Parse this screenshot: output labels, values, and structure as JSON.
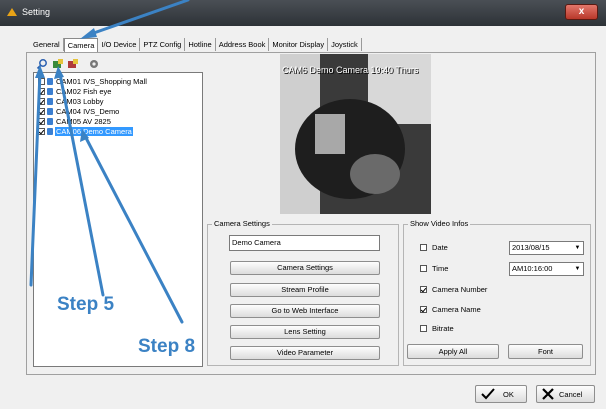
{
  "window": {
    "title": "Setting",
    "close_glyph": "x"
  },
  "tabs": [
    "General",
    "Camera",
    "I/O Device",
    "PTZ Config",
    "Hotline",
    "Address Book",
    "Monitor Display",
    "Joystick"
  ],
  "active_tab": "Camera",
  "toolbar": {
    "icons": [
      "search-icon",
      "add-camera-icon",
      "delete-camera-icon",
      "settings-gear-icon"
    ]
  },
  "cameras": [
    {
      "label": "CAM01 IVS_Shopping Mall",
      "checked": false,
      "selected": false
    },
    {
      "label": "CAM02 Fish eye",
      "checked": true,
      "selected": false
    },
    {
      "label": "CAM03 Lobby",
      "checked": true,
      "selected": false
    },
    {
      "label": "CAM04 IVS_Demo",
      "checked": true,
      "selected": false
    },
    {
      "label": "CAM05 AV 2825",
      "checked": true,
      "selected": false
    },
    {
      "label": "CAM06 Demo Camera",
      "checked": true,
      "selected": true
    }
  ],
  "video": {
    "overlay_text": "CAM6 Demo Camera 19:40 Thurs"
  },
  "camera_settings": {
    "legend": "Camera Settings",
    "name_value": "Demo Camera",
    "buttons": [
      "Camera Settings",
      "Stream Profile",
      "Go to Web Interface",
      "Lens Setting",
      "Video Parameter"
    ]
  },
  "show_video_infos": {
    "legend": "Show Video Infos",
    "options": [
      {
        "label": "Date",
        "checked": false
      },
      {
        "label": "Time",
        "checked": false
      },
      {
        "label": "Camera Number",
        "checked": true
      },
      {
        "label": "Camera Name",
        "checked": true
      },
      {
        "label": "Bitrate",
        "checked": false
      }
    ],
    "date_value": "2013/08/15",
    "time_value": "AM10:16:00",
    "apply_label": "Apply All",
    "font_label": "Font"
  },
  "footer": {
    "ok_label": "OK",
    "cancel_label": "Cancel"
  },
  "annotations": {
    "step5": "Step 5",
    "step8": "Step 8"
  },
  "colors": {
    "annotation": "#3b82c4",
    "selection": "#3399ff",
    "close_button": "#c1402f"
  }
}
